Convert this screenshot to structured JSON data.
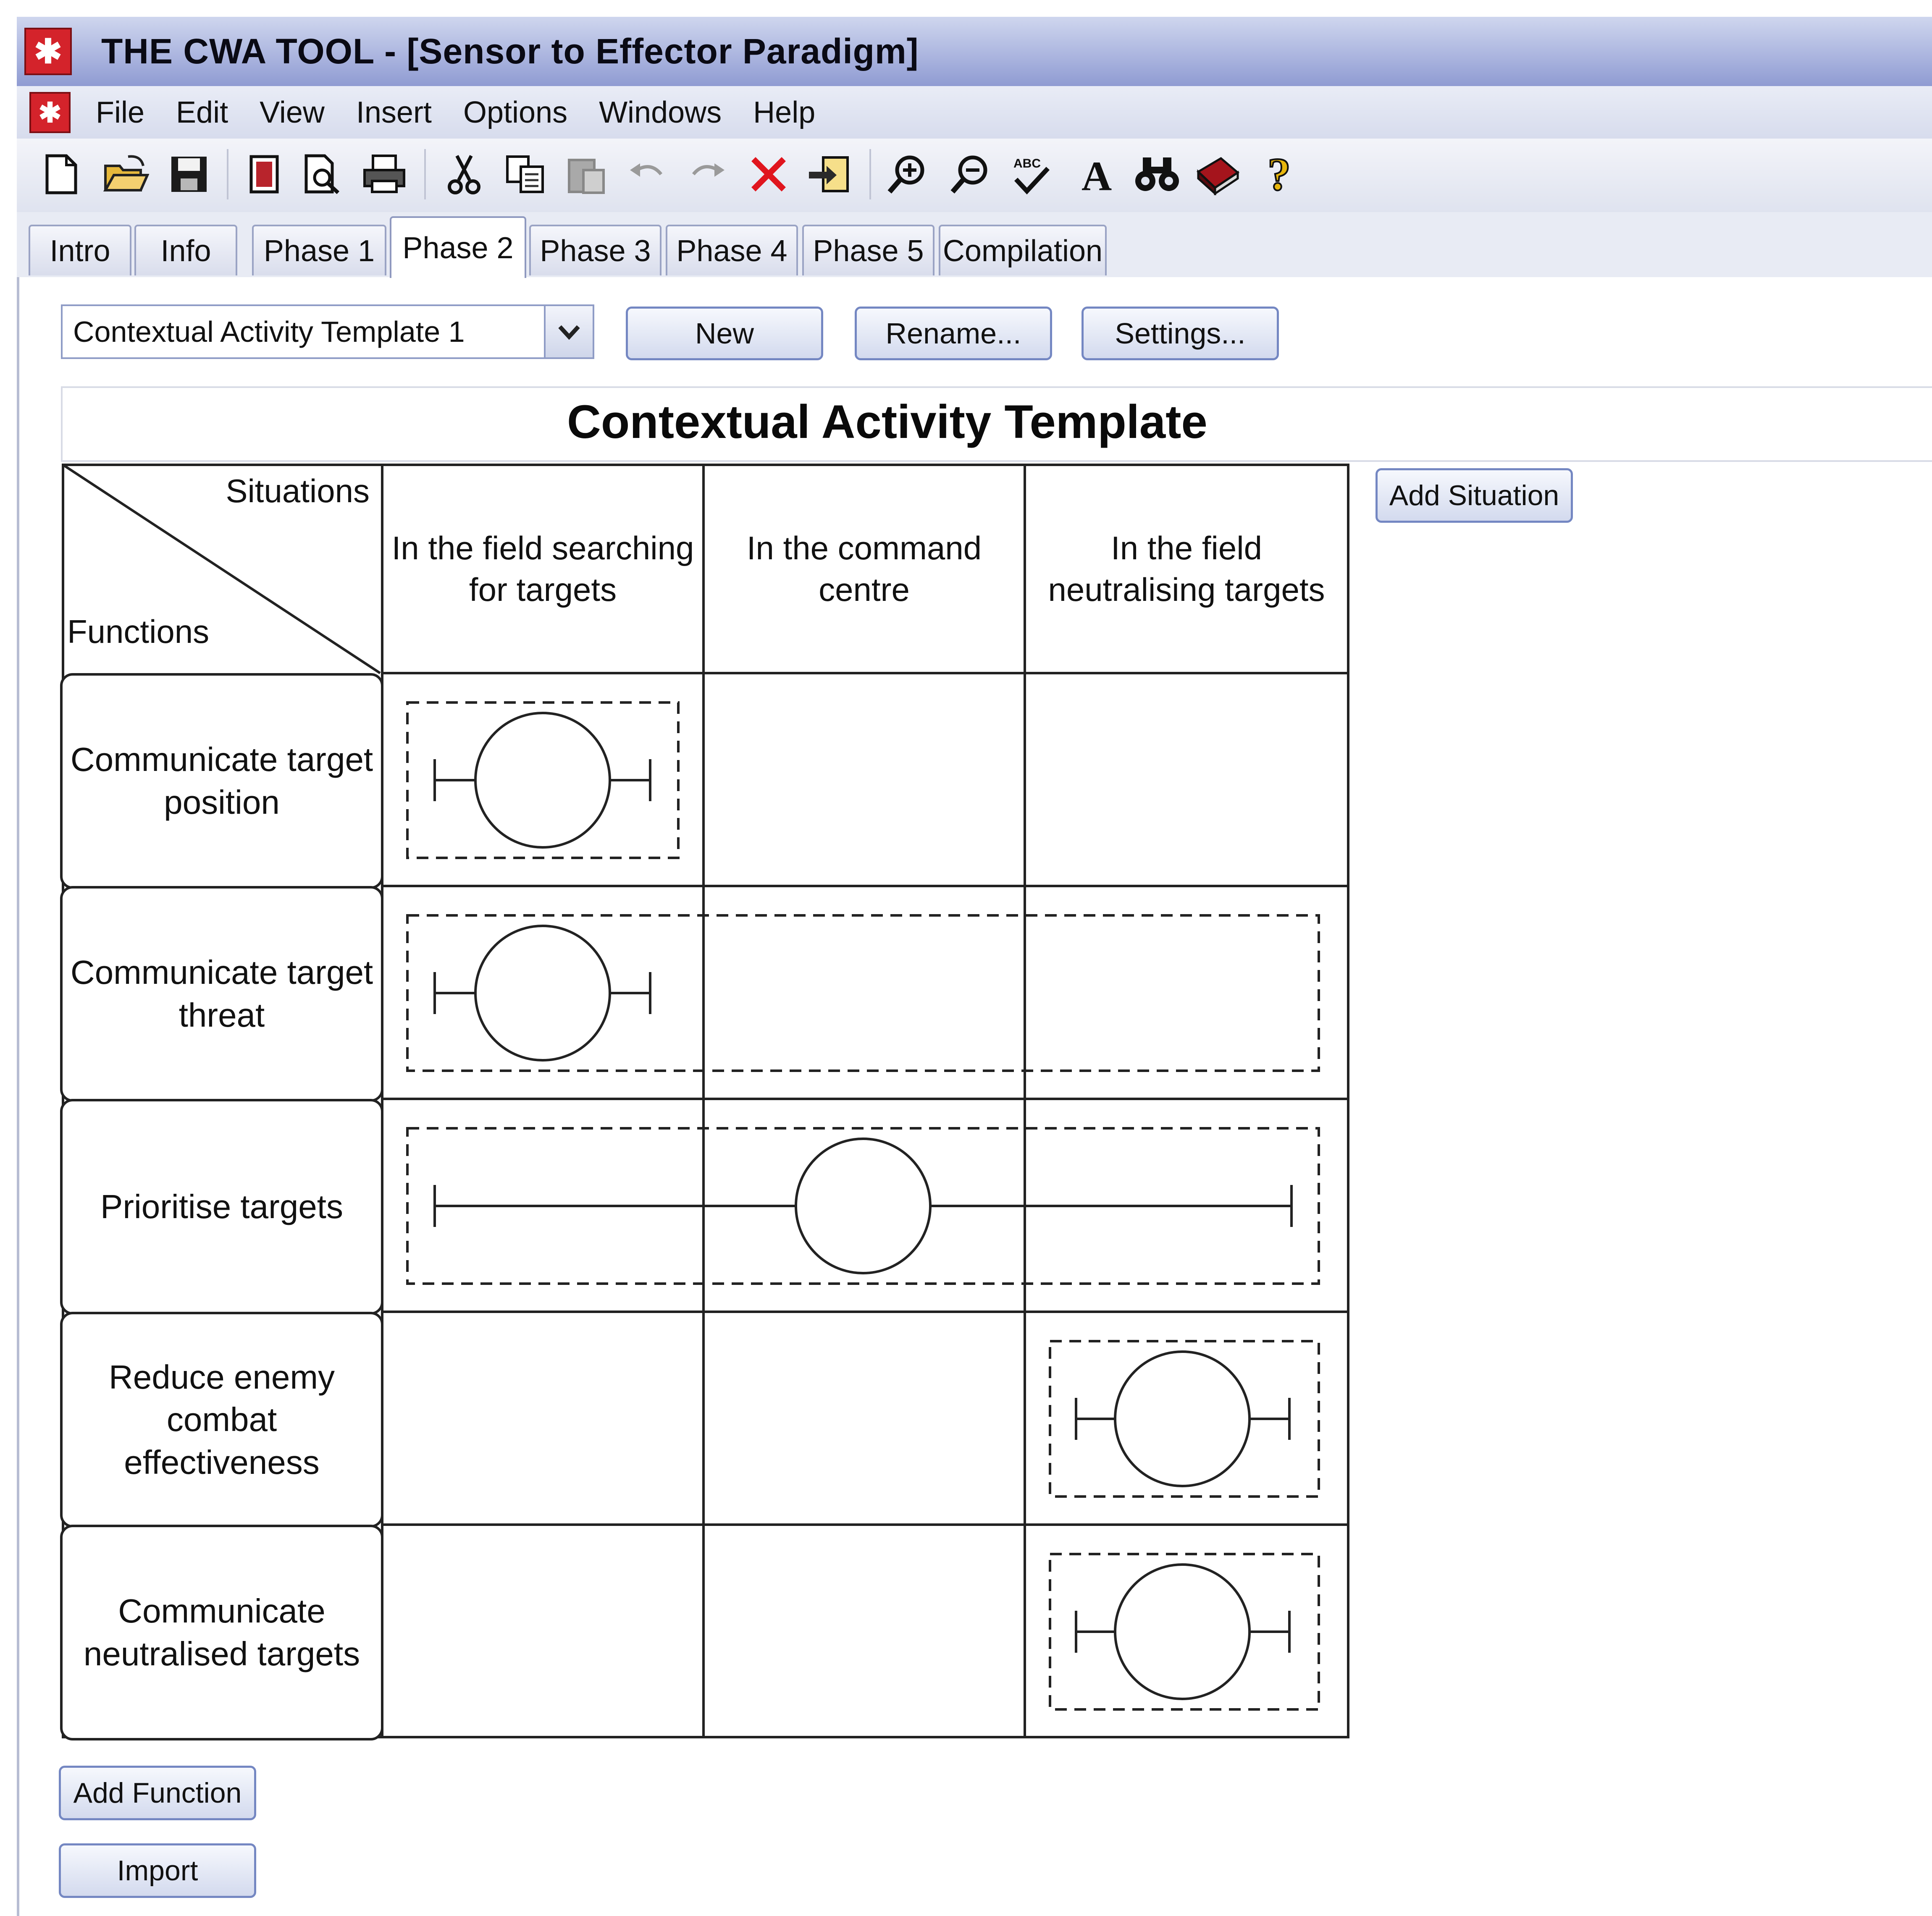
{
  "window": {
    "title": "THE CWA TOOL - [Sensor to Effector Paradigm]",
    "app_icon": "cwa-app-icon"
  },
  "menu": [
    "File",
    "Edit",
    "View",
    "Insert",
    "Options",
    "Windows",
    "Help"
  ],
  "toolbar": {
    "icons": [
      "new-document-icon",
      "open-folder-icon",
      "save-icon",
      "copy-page-icon",
      "print-preview-icon",
      "print-icon",
      "cut-icon",
      "copy-icon",
      "paste-icon",
      "undo-icon",
      "redo-icon",
      "delete-icon",
      "import-icon",
      "zoom-in-icon",
      "zoom-out-icon",
      "spell-check-icon",
      "font-icon",
      "find-icon",
      "book-icon",
      "help-icon"
    ]
  },
  "tabs": [
    "Intro",
    "Info",
    "Phase 1",
    "Phase 2",
    "Phase 3",
    "Phase 4",
    "Phase 5",
    "Compilation"
  ],
  "active_tab": "Phase 2",
  "controls": {
    "template_select_value": "Contextual Activity Template 1",
    "new_label": "New",
    "rename_label": "Rename...",
    "settings_label": "Settings...",
    "add_situation_label": "Add Situation",
    "add_function_label": "Add Function",
    "import_label": "Import"
  },
  "template": {
    "title": "Contextual Activity Template",
    "corner_top": "Situations",
    "corner_bottom": "Functions",
    "situations": [
      "In the field searching for targets",
      "In the command centre",
      "In the field neutralising targets"
    ],
    "functions": [
      "Communicate target position",
      "Communicate target threat",
      "Prioritise targets",
      "Reduce enemy combat effectiveness",
      "Communicate neutralised targets"
    ],
    "activities": [
      {
        "function": "Communicate target position",
        "box": [
          0,
          0
        ],
        "whisker": [
          0,
          0
        ],
        "circle": 0
      },
      {
        "function": "Communicate target threat",
        "box": [
          0,
          2
        ],
        "whisker": [
          0,
          0
        ],
        "circle": 0
      },
      {
        "function": "Prioritise targets",
        "box": [
          0,
          2
        ],
        "whisker": [
          0,
          2
        ],
        "circle": 1
      },
      {
        "function": "Reduce enemy combat effectiveness",
        "box": [
          2,
          2
        ],
        "whisker": [
          2,
          2
        ],
        "circle": 2
      },
      {
        "function": "Communicate neutralised targets",
        "box": [
          2,
          2
        ],
        "whisker": [
          2,
          2
        ],
        "circle": 2
      }
    ]
  }
}
